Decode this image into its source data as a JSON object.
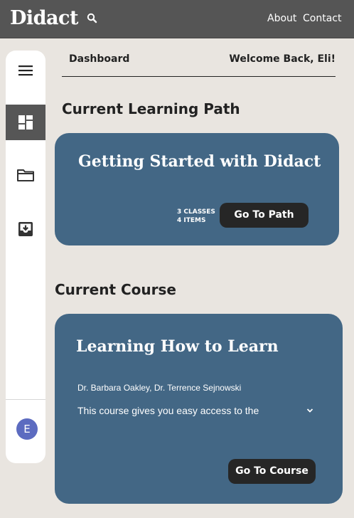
{
  "app": {
    "brand": "Didact"
  },
  "nav": {
    "about": "About",
    "contact": "Contact"
  },
  "header": {
    "breadcrumb": "Dashboard",
    "welcome": "Welcome Back, Eli!"
  },
  "sidebar": {
    "avatar_initial": "E",
    "icons": [
      "menu-icon",
      "dashboard-icon",
      "folder-icon",
      "archive-icon"
    ]
  },
  "learning_path": {
    "section_title": "Current Learning Path",
    "title": "Getting Started with Didact",
    "classes": "3 CLASSES",
    "items": "4 ITEMS",
    "button": "Go To Path"
  },
  "course": {
    "section_title": "Current Course",
    "title": "Learning How to Learn",
    "authors": "Dr. Barbara Oakley, Dr. Terrence Sejnowski",
    "description": "This course gives you easy access to the",
    "button": "Go To Course"
  },
  "colors": {
    "topbar": "#555555",
    "background": "#e9e5e0",
    "card": "#436785",
    "button": "#262626",
    "avatar": "#5c6bc0"
  }
}
